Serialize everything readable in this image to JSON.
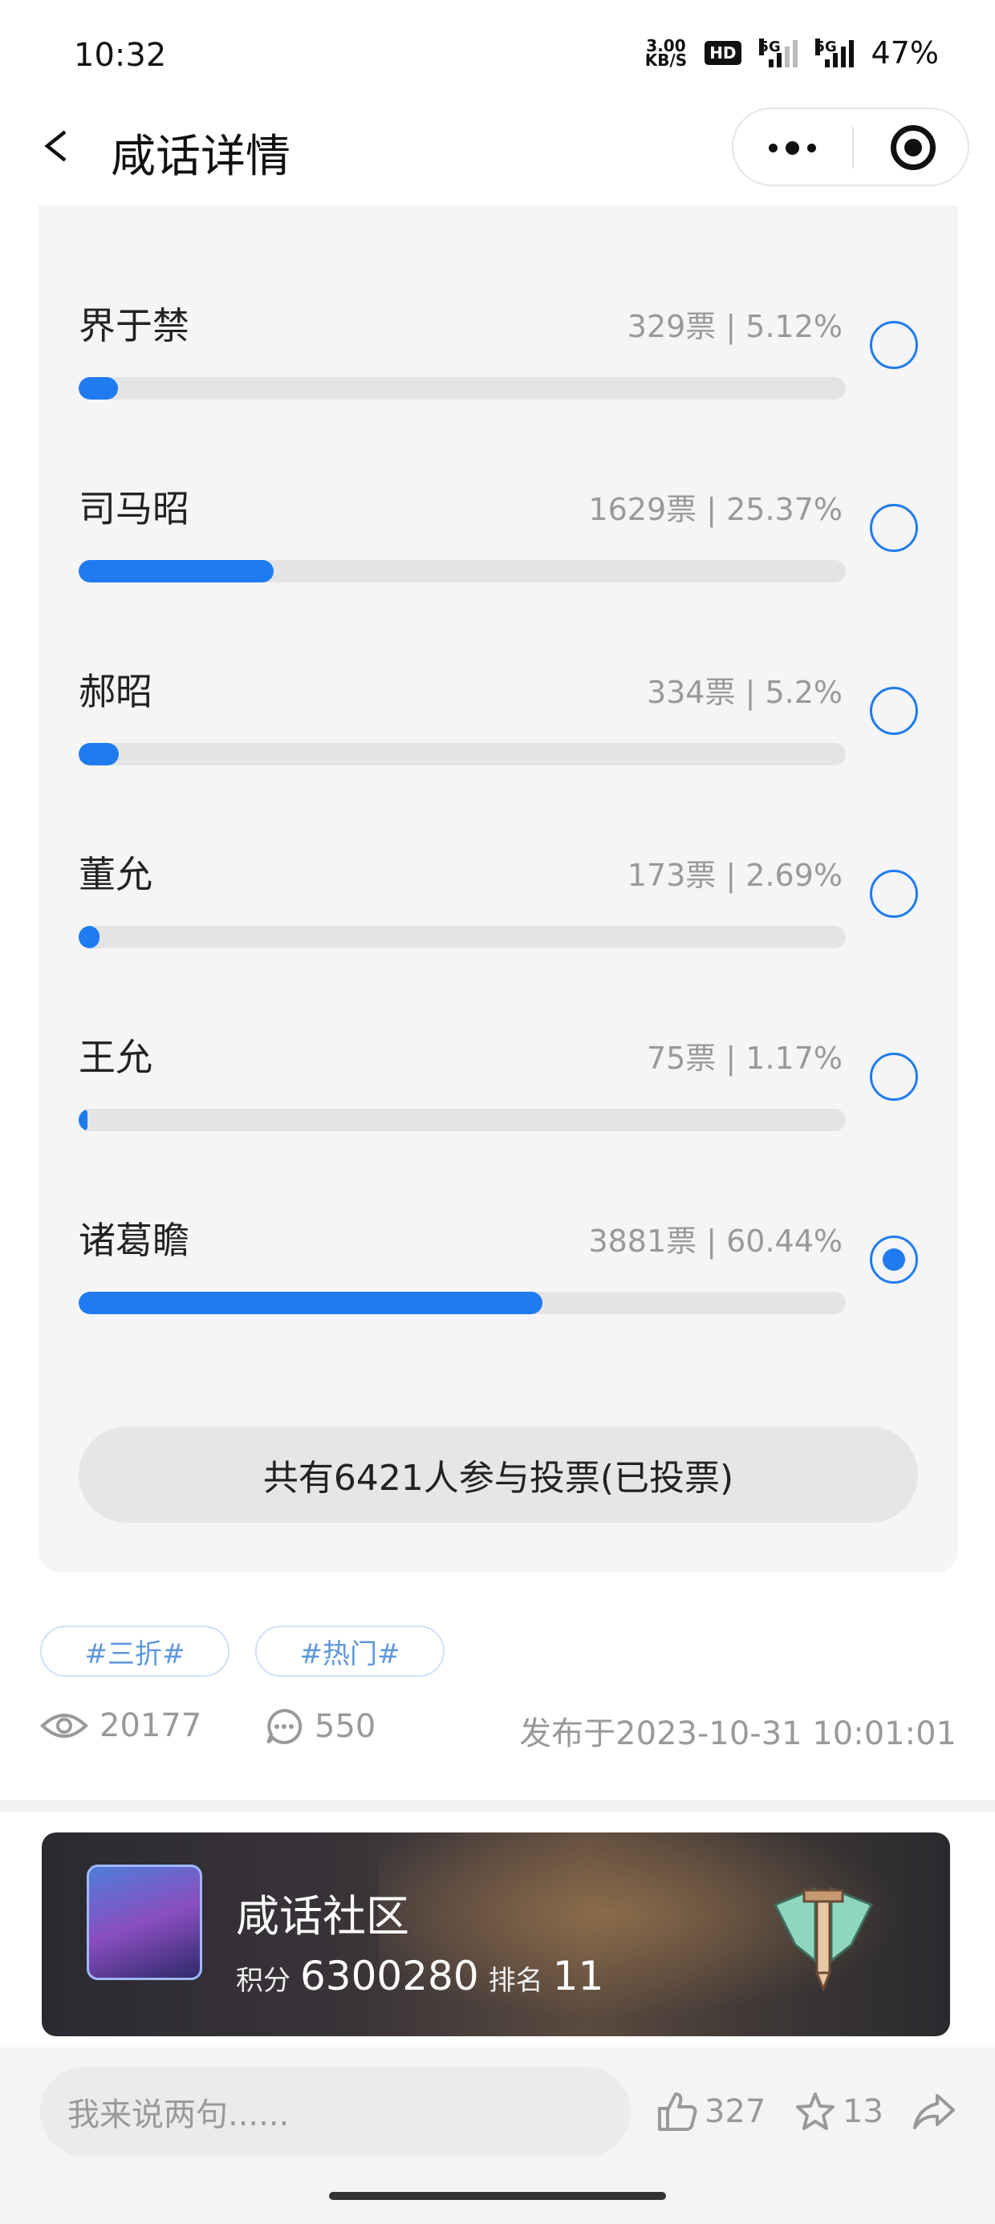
{
  "status_bar": {
    "time": "10:32",
    "speed_top": "3.00",
    "speed_bottom": "KB/S",
    "hd": "HD",
    "net1": "5G",
    "net2": "5G",
    "battery": "47%"
  },
  "header": {
    "title": "咸话详情"
  },
  "poll": {
    "accent": "#1e7bf0",
    "options": [
      {
        "name": "界于禁",
        "stat": "329票 | 5.12%",
        "fraction": 0.0512,
        "selected": false
      },
      {
        "name": "司马昭",
        "stat": "1629票 | 25.37%",
        "fraction": 0.2537,
        "selected": false
      },
      {
        "name": "郝昭",
        "stat": "334票 | 5.2%",
        "fraction": 0.052,
        "selected": false
      },
      {
        "name": "董允",
        "stat": "173票 | 2.69%",
        "fraction": 0.0269,
        "selected": false
      },
      {
        "name": "王允",
        "stat": "75票 | 1.17%",
        "fraction": 0.0117,
        "selected": false
      },
      {
        "name": "诸葛瞻",
        "stat": "3881票 | 60.44%",
        "fraction": 0.6044,
        "selected": true
      }
    ],
    "total_label": "共有6421人参与投票(已投票)"
  },
  "tags": [
    "#三折#",
    "#热门#"
  ],
  "meta": {
    "views": "20177",
    "comments": "550",
    "published": "发布于2023-10-31 10:01:01"
  },
  "community": {
    "name": "咸话社区",
    "points_label": "积分",
    "points": "6300280",
    "rank_label": "排名",
    "rank": "11"
  },
  "bottom_bar": {
    "input_placeholder": "我来说两句......",
    "likes": "327",
    "favorites": "13"
  }
}
